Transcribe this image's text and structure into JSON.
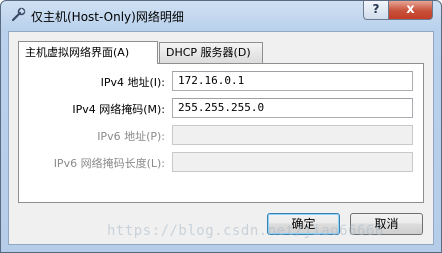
{
  "window": {
    "title": "仅主机(Host-Only)网络明细",
    "help_label": "?",
    "close_label": "x"
  },
  "tabs": [
    {
      "label": "主机虚拟网络界面(A)",
      "active": true
    },
    {
      "label": "DHCP 服务器(D)",
      "active": false
    }
  ],
  "fields": [
    {
      "label": "IPv4 地址(I):",
      "value": "172.16.0.1",
      "enabled": true
    },
    {
      "label": "IPv4 网络掩码(M):",
      "value": "255.255.255.0",
      "enabled": true
    },
    {
      "label": "IPv6 地址(P):",
      "value": "",
      "enabled": false
    },
    {
      "label": "IPv6 网络掩码长度(L):",
      "value": "",
      "enabled": false
    }
  ],
  "buttons": {
    "ok": "确定",
    "cancel": "取消"
  },
  "watermark": "https://blog.csdn.net/jiao66666"
}
